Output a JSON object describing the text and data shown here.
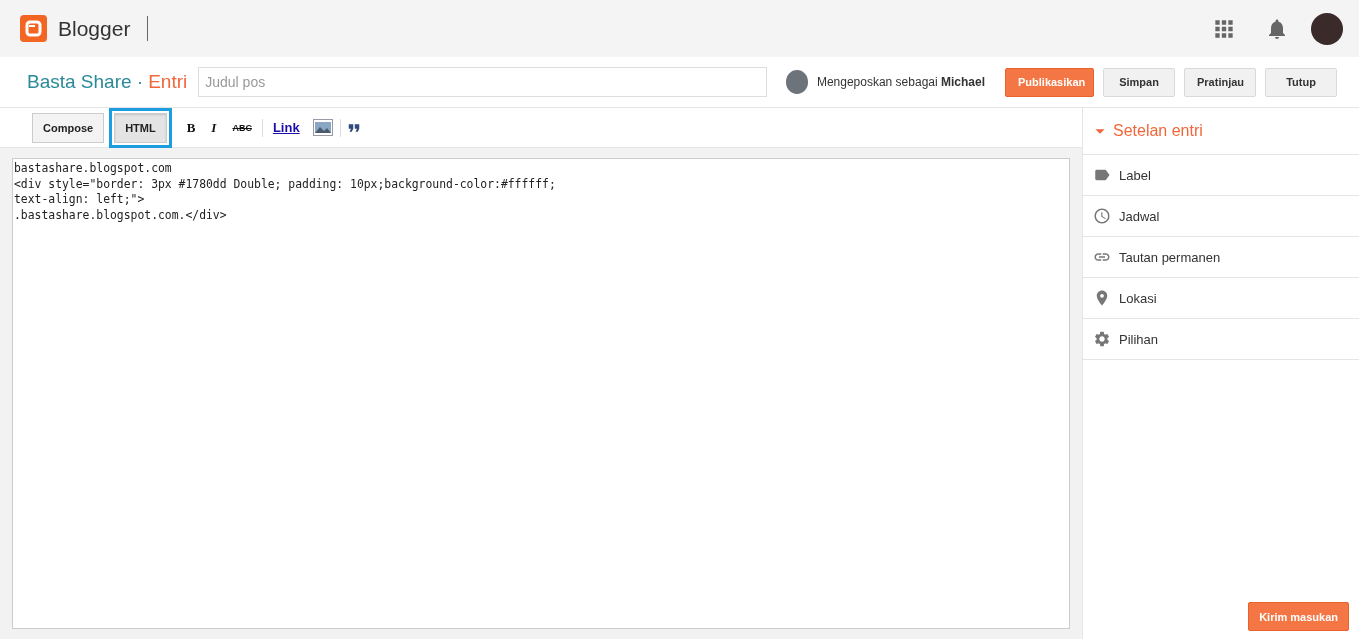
{
  "app": {
    "name": "Blogger"
  },
  "post_header": {
    "blog": "Basta Share",
    "separator": "·",
    "section": "Entri",
    "title_placeholder": "Judul pos",
    "posting_as": "Mengeposkan sebagai **Michael**",
    "buttons": [
      {
        "label": "Publikasikan",
        "kind": "primary"
      },
      {
        "label": "Simpan",
        "kind": "default"
      },
      {
        "label": "Pratinjau",
        "kind": "default"
      },
      {
        "label": "Tutup",
        "kind": "default"
      }
    ]
  },
  "mode_tabs": [
    {
      "label": "Compose",
      "selected": false,
      "highlighted": false
    },
    {
      "label": "HTML",
      "selected": true,
      "highlighted": true
    }
  ],
  "format_tools": [
    {
      "kind": "bold",
      "label": "B"
    },
    {
      "kind": "italic",
      "label": "I"
    },
    {
      "kind": "strike",
      "label": "ABC"
    },
    {
      "kind": "link",
      "label": "Link"
    },
    {
      "kind": "image"
    },
    {
      "kind": "quote"
    }
  ],
  "editor": {
    "lines": [
      "bastashare.blogspot.com",
      "<div style=\"border: 3px #1780dd Double; padding: 10px;background-color:#ffffff;",
      "text-align: left;\">",
      ".bastashare.blogspot.com.</div>"
    ]
  },
  "sidebar": {
    "title": "Setelan entri",
    "expanded": true,
    "items": [
      {
        "kind": "label",
        "label": "Label"
      },
      {
        "kind": "schedule",
        "label": "Jadwal"
      },
      {
        "kind": "permalink",
        "label": "Tautan permanen"
      },
      {
        "kind": "location",
        "label": "Lokasi"
      },
      {
        "kind": "options",
        "label": "Pilihan"
      }
    ]
  },
  "feedback_button": "Kirim masukan"
}
